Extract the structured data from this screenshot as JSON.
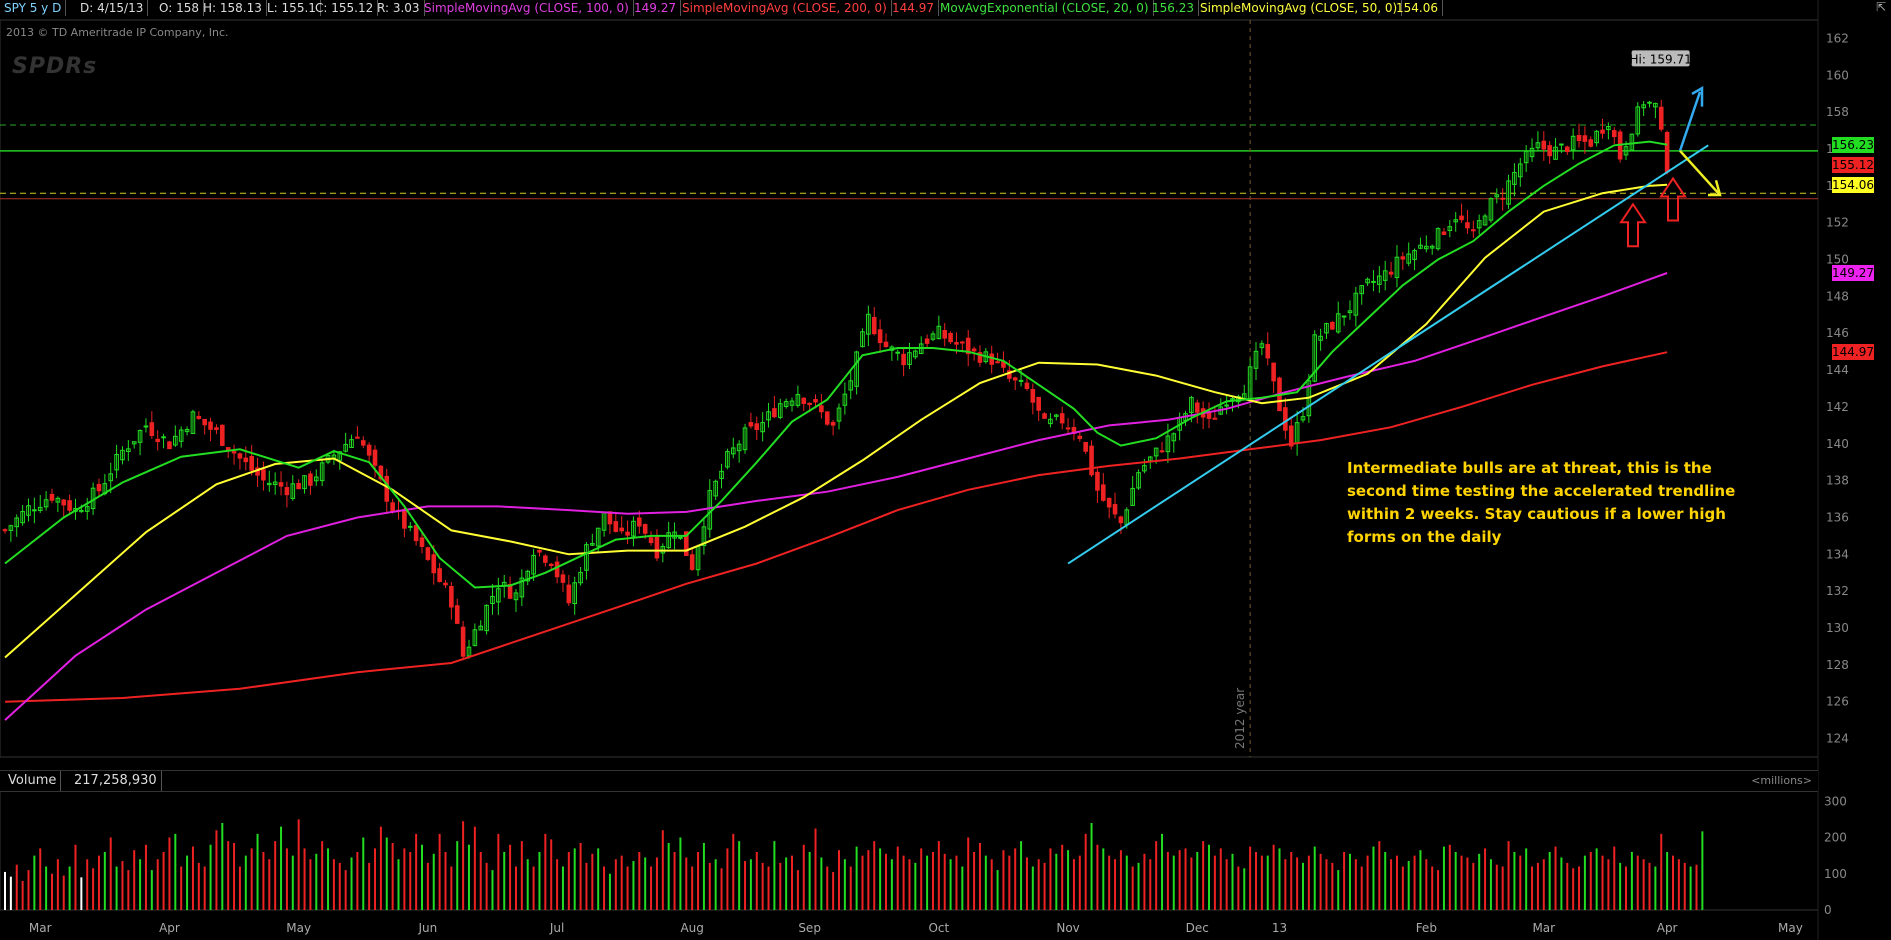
{
  "header": {
    "symbol": "SPY 5 y D",
    "date": "D: 4/15/13",
    "open": "O: 158",
    "high": "H: 158.13",
    "low": "L: 155.1",
    "close": "C: 155.12",
    "range": "R: 3.03",
    "sma100_label": "SimpleMovingAvg (CLOSE, 100, 0)",
    "sma100_value": "149.27",
    "sma200_label": "SimpleMovingAvg (CLOSE, 200, 0)",
    "sma200_value": "144.97",
    "ema20_label": "MovAvgExponential (CLOSE, 20, 0)",
    "ema20_value": "156.23",
    "sma50_label": "SimpleMovingAvg (CLOSE, 50, 0)",
    "sma50_value": "154.06"
  },
  "copyright": "2013 © TD Ameritrade IP Company, Inc.",
  "logo_text": "SPDRs",
  "year_marker": "2012 year",
  "hi_label": "Hi: 159.71",
  "annotation": "Intermediate bulls are at threat, this is the second time testing the accelerated trendline within 2 weeks. Stay cautious if a lower high forms on the daily",
  "volume_panel": {
    "label": "Volume",
    "value": "217,258,930",
    "unit": "<millions>",
    "ticks": [
      "300",
      "200",
      "100",
      "0"
    ]
  },
  "price_tags": [
    {
      "text": "156.23",
      "value": 156.23,
      "color": "#22dd22"
    },
    {
      "text": "155.12",
      "value": 155.12,
      "color": "#ee2222"
    },
    {
      "text": "154.06",
      "value": 154.06,
      "color": "#ffff22"
    },
    {
      "text": "149.27",
      "value": 149.27,
      "color": "#ee22ee"
    },
    {
      "text": "144.97",
      "value": 144.97,
      "color": "#ee2222"
    }
  ],
  "colors": {
    "ema20": "#22dd22",
    "sma50": "#ffff33",
    "sma100": "#e020e0",
    "sma200": "#ee2222",
    "trendline": "#33ccee",
    "up_candle": "#22dd22",
    "down_candle": "#ee2222"
  },
  "chart_data": {
    "type": "candlestick",
    "ylim": [
      123,
      163
    ],
    "y_ticks": [
      124,
      126,
      128,
      130,
      132,
      134,
      136,
      138,
      140,
      142,
      144,
      146,
      148,
      150,
      152,
      154,
      156,
      158,
      160,
      162
    ],
    "x_labels": [
      "Mar",
      "Apr",
      "May",
      "Jun",
      "Jul",
      "Aug",
      "Sep",
      "Oct",
      "Nov",
      "Dec",
      "13",
      "Feb",
      "Mar",
      "Apr",
      "May"
    ],
    "close_path": [
      [
        0,
        135.3
      ],
      [
        4,
        136.5
      ],
      [
        8,
        137.2
      ],
      [
        12,
        136.4
      ],
      [
        16,
        137.5
      ],
      [
        20,
        139.6
      ],
      [
        24,
        141.0
      ],
      [
        28,
        140.0
      ],
      [
        32,
        141.5
      ],
      [
        36,
        140.6
      ],
      [
        40,
        139.2
      ],
      [
        44,
        138.0
      ],
      [
        48,
        137.6
      ],
      [
        52,
        138.0
      ],
      [
        56,
        139.4
      ],
      [
        60,
        140.6
      ],
      [
        62,
        139.2
      ],
      [
        66,
        136.5
      ],
      [
        70,
        134.7
      ],
      [
        73,
        133.1
      ],
      [
        76,
        131.5
      ],
      [
        78,
        128.5
      ],
      [
        81,
        130.5
      ],
      [
        84,
        132.4
      ],
      [
        87,
        131.8
      ],
      [
        90,
        134.3
      ],
      [
        93,
        133.7
      ],
      [
        96,
        131.4
      ],
      [
        99,
        134.3
      ],
      [
        102,
        136.1
      ],
      [
        105,
        134.9
      ],
      [
        108,
        135.8
      ],
      [
        111,
        134.2
      ],
      [
        114,
        135.5
      ],
      [
        117,
        133.4
      ],
      [
        120,
        137.1
      ],
      [
        123,
        139.2
      ],
      [
        126,
        140.5
      ],
      [
        129,
        141.1
      ],
      [
        132,
        142.2
      ],
      [
        135,
        142.8
      ],
      [
        138,
        142.0
      ],
      [
        141,
        140.9
      ],
      [
        144,
        143.5
      ],
      [
        147,
        146.8
      ],
      [
        150,
        145.3
      ],
      [
        153,
        144.6
      ],
      [
        156,
        145.5
      ],
      [
        159,
        146.0
      ],
      [
        162,
        145.4
      ],
      [
        165,
        144.9
      ],
      [
        168,
        144.6
      ],
      [
        171,
        143.5
      ],
      [
        174,
        142.9
      ],
      [
        177,
        141.0
      ],
      [
        180,
        141.3
      ],
      [
        183,
        140.5
      ],
      [
        186,
        137.5
      ],
      [
        188,
        136.4
      ],
      [
        190,
        135.7
      ],
      [
        193,
        138.5
      ],
      [
        196,
        139.5
      ],
      [
        199,
        140.6
      ],
      [
        202,
        142.2
      ],
      [
        205,
        141.1
      ],
      [
        208,
        142.5
      ],
      [
        211,
        143.1
      ],
      [
        214,
        145.4
      ],
      [
        217,
        142.0
      ],
      [
        219,
        140.0
      ],
      [
        221,
        141.8
      ],
      [
        223,
        145.6
      ],
      [
        226,
        146.5
      ],
      [
        229,
        147.4
      ],
      [
        232,
        148.6
      ],
      [
        235,
        149.2
      ],
      [
        238,
        150.1
      ],
      [
        241,
        150.7
      ],
      [
        244,
        151.3
      ],
      [
        247,
        152.4
      ],
      [
        250,
        151.2
      ],
      [
        252,
        152.7
      ],
      [
        255,
        153.6
      ],
      [
        258,
        155.2
      ],
      [
        261,
        156.1
      ],
      [
        264,
        155.9
      ],
      [
        267,
        156.3
      ],
      [
        270,
        156.4
      ],
      [
        273,
        157.6
      ],
      [
        275,
        155.6
      ],
      [
        277,
        157.2
      ],
      [
        279,
        158.6
      ],
      [
        281,
        158.3
      ],
      [
        283,
        155.1
      ]
    ],
    "ema20_path": [
      [
        0,
        133.5
      ],
      [
        10,
        136.0
      ],
      [
        20,
        137.9
      ],
      [
        30,
        139.3
      ],
      [
        40,
        139.7
      ],
      [
        50,
        138.7
      ],
      [
        56,
        139.6
      ],
      [
        62,
        139.0
      ],
      [
        68,
        136.6
      ],
      [
        74,
        133.8
      ],
      [
        80,
        132.2
      ],
      [
        86,
        132.3
      ],
      [
        92,
        133.0
      ],
      [
        98,
        133.9
      ],
      [
        104,
        134.8
      ],
      [
        110,
        135.0
      ],
      [
        116,
        135.0
      ],
      [
        122,
        136.9
      ],
      [
        128,
        139.0
      ],
      [
        134,
        141.2
      ],
      [
        140,
        142.4
      ],
      [
        146,
        144.8
      ],
      [
        152,
        145.2
      ],
      [
        158,
        145.2
      ],
      [
        164,
        145.0
      ],
      [
        170,
        144.5
      ],
      [
        176,
        143.2
      ],
      [
        182,
        141.9
      ],
      [
        186,
        140.6
      ],
      [
        190,
        139.9
      ],
      [
        196,
        140.3
      ],
      [
        202,
        141.4
      ],
      [
        208,
        142.3
      ],
      [
        214,
        142.5
      ],
      [
        220,
        142.8
      ],
      [
        226,
        145.0
      ],
      [
        232,
        146.8
      ],
      [
        238,
        148.6
      ],
      [
        244,
        150.0
      ],
      [
        250,
        151.0
      ],
      [
        256,
        152.6
      ],
      [
        262,
        154.0
      ],
      [
        268,
        155.2
      ],
      [
        274,
        156.2
      ],
      [
        280,
        156.4
      ],
      [
        283,
        156.23
      ]
    ],
    "sma50_path": [
      [
        0,
        128.4
      ],
      [
        12,
        131.8
      ],
      [
        24,
        135.2
      ],
      [
        36,
        137.8
      ],
      [
        46,
        138.9
      ],
      [
        56,
        139.2
      ],
      [
        66,
        137.5
      ],
      [
        76,
        135.3
      ],
      [
        86,
        134.7
      ],
      [
        96,
        134.0
      ],
      [
        106,
        134.2
      ],
      [
        116,
        134.2
      ],
      [
        126,
        135.5
      ],
      [
        136,
        137.1
      ],
      [
        146,
        139.1
      ],
      [
        156,
        141.3
      ],
      [
        166,
        143.3
      ],
      [
        176,
        144.4
      ],
      [
        186,
        144.3
      ],
      [
        196,
        143.7
      ],
      [
        206,
        142.8
      ],
      [
        214,
        142.2
      ],
      [
        222,
        142.5
      ],
      [
        232,
        143.8
      ],
      [
        242,
        146.5
      ],
      [
        252,
        150.1
      ],
      [
        262,
        152.6
      ],
      [
        272,
        153.6
      ],
      [
        280,
        154.0
      ],
      [
        283,
        154.06
      ]
    ],
    "sma100_path": [
      [
        0,
        125.0
      ],
      [
        12,
        128.5
      ],
      [
        24,
        131.0
      ],
      [
        36,
        133.0
      ],
      [
        48,
        135.0
      ],
      [
        60,
        136.0
      ],
      [
        72,
        136.6
      ],
      [
        84,
        136.6
      ],
      [
        96,
        136.4
      ],
      [
        106,
        136.2
      ],
      [
        116,
        136.3
      ],
      [
        128,
        136.9
      ],
      [
        140,
        137.4
      ],
      [
        152,
        138.2
      ],
      [
        164,
        139.2
      ],
      [
        176,
        140.2
      ],
      [
        188,
        141.0
      ],
      [
        198,
        141.3
      ],
      [
        208,
        141.9
      ],
      [
        218,
        142.8
      ],
      [
        228,
        143.6
      ],
      [
        240,
        144.5
      ],
      [
        252,
        145.8
      ],
      [
        262,
        146.9
      ],
      [
        272,
        148.0
      ],
      [
        283,
        149.27
      ]
    ],
    "sma200_path": [
      [
        0,
        126.0
      ],
      [
        20,
        126.2
      ],
      [
        40,
        126.7
      ],
      [
        60,
        127.6
      ],
      [
        76,
        128.1
      ],
      [
        90,
        129.6
      ],
      [
        104,
        131.1
      ],
      [
        116,
        132.4
      ],
      [
        128,
        133.5
      ],
      [
        140,
        134.9
      ],
      [
        152,
        136.4
      ],
      [
        164,
        137.5
      ],
      [
        176,
        138.3
      ],
      [
        188,
        138.8
      ],
      [
        200,
        139.2
      ],
      [
        212,
        139.7
      ],
      [
        224,
        140.2
      ],
      [
        236,
        140.9
      ],
      [
        248,
        142.0
      ],
      [
        260,
        143.2
      ],
      [
        272,
        144.2
      ],
      [
        283,
        144.97
      ]
    ],
    "volume_max": 320,
    "volume_values": [
      105,
      92,
      125,
      80,
      110,
      150,
      170,
      120,
      100,
      140,
      95,
      120,
      180,
      90,
      140,
      115,
      150,
      160,
      200,
      120,
      135,
      110,
      165,
      140,
      180,
      110,
      140,
      160,
      200,
      210,
      120,
      150,
      175,
      130,
      120,
      180,
      220,
      240,
      190,
      185,
      120,
      150,
      170,
      210,
      160,
      140,
      190,
      230,
      170,
      150,
      250,
      170,
      140,
      155,
      190,
      170,
      140,
      130,
      110,
      145,
      160,
      200,
      130,
      170,
      230,
      200,
      185,
      140,
      170,
      160,
      210,
      180,
      130,
      155,
      210,
      160,
      120,
      190,
      245,
      180,
      230,
      160,
      130,
      110,
      210,
      160,
      180,
      120,
      190,
      140,
      120,
      160,
      210,
      195,
      140,
      120,
      160,
      170,
      185,
      130,
      155,
      170,
      120,
      100,
      140,
      150,
      120,
      135,
      160,
      145,
      120,
      145,
      220,
      185,
      160,
      200,
      145,
      120,
      160,
      185,
      130,
      140,
      115,
      170,
      210,
      190,
      135,
      140,
      160,
      130,
      120,
      190,
      130,
      145,
      150,
      110,
      180,
      160,
      225,
      145,
      120,
      105,
      165,
      140,
      120,
      175,
      150,
      165,
      190,
      170,
      155,
      140,
      175,
      150,
      140,
      130,
      170,
      150,
      160,
      190,
      155,
      140,
      150,
      120,
      200,
      160,
      185,
      150,
      140,
      110,
      165,
      150,
      170,
      190,
      145,
      120,
      140,
      130,
      170,
      155,
      180,
      165,
      140,
      150,
      210,
      240,
      180,
      170,
      150,
      140,
      165,
      150,
      120,
      130,
      155,
      140,
      190,
      210,
      160,
      150,
      165,
      170,
      145,
      160,
      190,
      180,
      150,
      170,
      140,
      155,
      120,
      115,
      175,
      160,
      150,
      150,
      180,
      170,
      140,
      160,
      145,
      130,
      150,
      175,
      155,
      140,
      130,
      110,
      160,
      155,
      140,
      120,
      150,
      175,
      190,
      160,
      140,
      150,
      120,
      135,
      150,
      165,
      140,
      120,
      110,
      175,
      180,
      160,
      150,
      145,
      130,
      155,
      170,
      140,
      125,
      120,
      190,
      160,
      150,
      170,
      120,
      130,
      140,
      160,
      175,
      145,
      130,
      115,
      120,
      150,
      160,
      170,
      150,
      140,
      175,
      130,
      120,
      160,
      150,
      140,
      130,
      120,
      210,
      160,
      150,
      140,
      130,
      120,
      125,
      217
    ]
  }
}
